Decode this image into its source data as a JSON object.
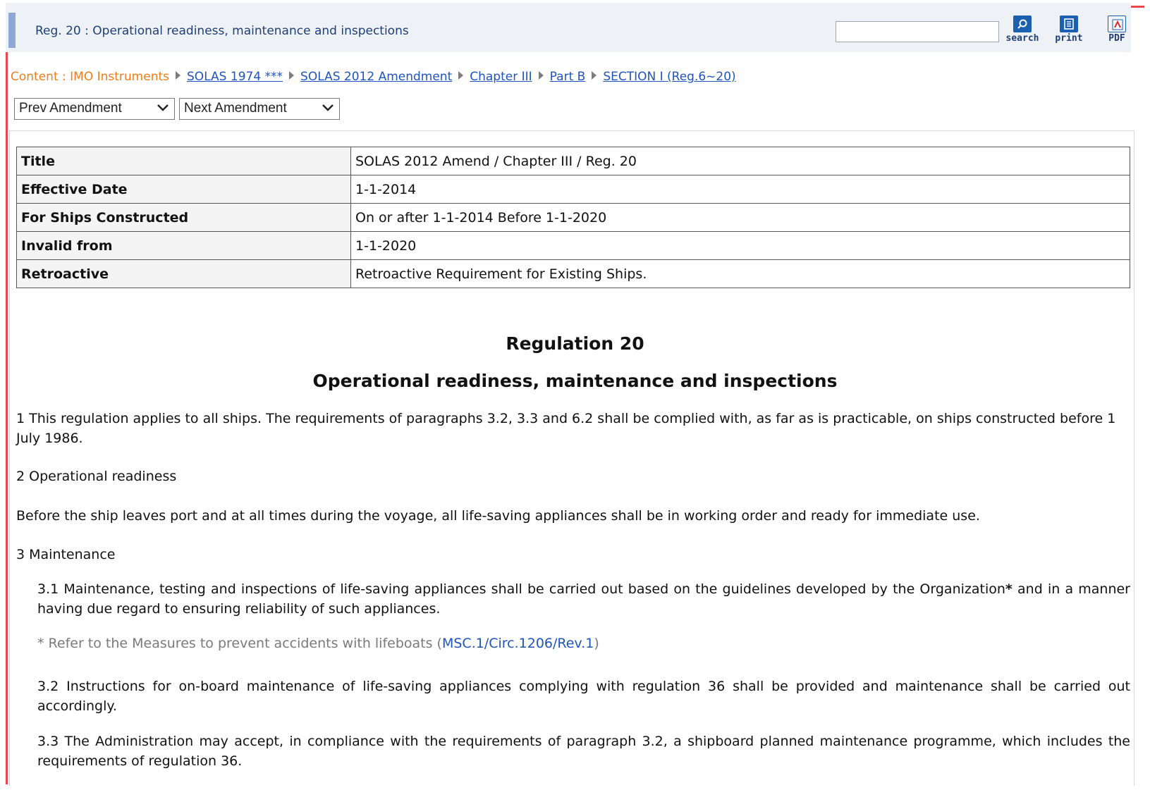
{
  "header": {
    "title": "Reg. 20 : Operational readiness, maintenance and inspections",
    "search_placeholder": "",
    "search_label": "search",
    "print_label": "print",
    "pdf_label": "PDF"
  },
  "breadcrumb": {
    "lead": "Content : IMO Instruments",
    "items": [
      "SOLAS 1974 ***",
      "SOLAS 2012 Amendment",
      "Chapter III",
      "Part B",
      "SECTION I (Reg.6~20)"
    ]
  },
  "amendments": {
    "prev": "Prev Amendment",
    "next": "Next Amendment"
  },
  "meta": [
    {
      "key": "Title",
      "value": "SOLAS 2012 Amend / Chapter III / Reg. 20"
    },
    {
      "key": "Effective Date",
      "value": "1-1-2014"
    },
    {
      "key": "For Ships Constructed",
      "value": "On or after 1-1-2014 Before 1-1-2020"
    },
    {
      "key": "Invalid from",
      "value": "1-1-2020"
    },
    {
      "key": "Retroactive",
      "value": "Retroactive Requirement for Existing Ships."
    }
  ],
  "regulation": {
    "number": "Regulation 20",
    "title": "Operational readiness, maintenance and inspections",
    "p1": "1 This regulation applies to all ships. The requirements of paragraphs 3.2, 3.3 and 6.2 shall be complied with, as far as is practicable, on ships constructed before 1 July 1986.",
    "p2_heading": "2 Operational readiness",
    "p2": "Before the ship leaves port and at all times during the voyage, all life-saving appliances shall be in working order and ready for immediate use.",
    "p3_heading": "3 Maintenance",
    "p3_1": "3.1 Maintenance, testing and inspections of life-saving appliances shall be carried out based on the guidelines developed by the Organization",
    "p3_1_star": "*",
    "p3_1_end": " and in a manner having due regard to ensuring reliability of such appliances.",
    "note_prefix": "* Refer to the Measures to prevent accidents with lifeboats (",
    "note_link": "MSC.1/Circ.1206/Rev.1",
    "note_suffix": ")",
    "p3_2": "3.2 Instructions for on-board maintenance of life-saving appliances complying with regulation 36 shall be provided and maintenance shall be carried out accordingly.",
    "p3_3": "3.3 The Administration may accept, in compliance with the requirements of paragraph 3.2, a shipboard planned maintenance programme, which includes the requirements of regulation 36."
  }
}
